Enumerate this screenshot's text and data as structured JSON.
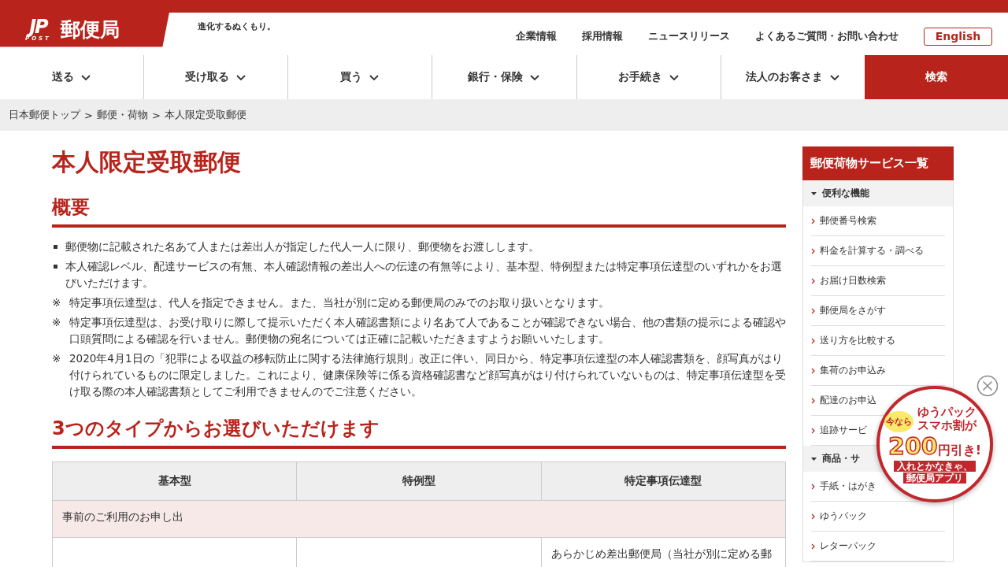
{
  "header": {
    "logo_mark": "JP",
    "logo_sub": "POST",
    "logo_text": "郵便局",
    "tagline": "進化するぬくもり。",
    "links": [
      "企業情報",
      "採用情報",
      "ニュースリリース",
      "よくあるご質問・お問い合わせ"
    ],
    "language_button": "English"
  },
  "nav": {
    "items": [
      {
        "label": "送る",
        "kind": "dropdown"
      },
      {
        "label": "受け取る",
        "kind": "dropdown"
      },
      {
        "label": "買う",
        "kind": "dropdown"
      },
      {
        "label": "銀行・保険",
        "kind": "dropdown"
      },
      {
        "label": "お手続き",
        "kind": "dropdown"
      },
      {
        "label": "法人のお客さま",
        "kind": "dropdown"
      },
      {
        "label": "検索",
        "kind": "search"
      }
    ]
  },
  "breadcrumb": {
    "items": [
      "日本郵便トップ",
      "郵便・荷物",
      "本人限定受取郵便"
    ],
    "separator": ">"
  },
  "page_title": "本人限定受取郵便",
  "sections": [
    {
      "heading": "概要",
      "notes": [
        {
          "kind": "bullet",
          "text": "郵便物に記載された名あて人または差出人が指定した代人一人に限り、郵便物をお渡しします。"
        },
        {
          "kind": "bullet",
          "text": "本人確認レベル、配達サービスの有無、本人確認情報の差出人への伝達の有無等により、基本型、特例型または特定事項伝達型のいずれかをお選びいただけます。"
        },
        {
          "kind": "note",
          "mark": "※",
          "text": "特定事項伝達型は、代人を指定できません。また、当社が別に定める郵便局のみでのお取り扱いとなります。"
        },
        {
          "kind": "note",
          "mark": "※",
          "text": "特定事項伝達型は、お受け取りに際して提示いただく本人確認書類により名あて人であることが確認できない場合、他の書類の提示による確認や口頭質問による確認を行いません。郵便物の宛名については正確に記載いただきますようお願いいたします。"
        },
        {
          "kind": "note",
          "mark": "※",
          "text": "2020年4月1日の「犯罪による収益の移転防止に関する法律施行規則」改正に伴い、同日から、特定事項伝達型の本人確認書類を、顔写真がはり付けられているものに限定しました。これにより、健康保険等に係る資格確認書など顔写真がはり付けられていないものは、特定事項伝達型を受け取る際の本人確認書類としてご利用できませんのでご注意ください。"
        }
      ]
    },
    {
      "heading": "3つのタイプからお選びいただけます",
      "table": {
        "columns": [
          "基本型",
          "特例型",
          "特定事項伝達型"
        ],
        "rows": [
          {
            "kind": "group",
            "text": "事前のご利用のお申し出"
          },
          {
            "kind": "data",
            "column_3": "あらかじめ差出郵便局（当社が別に定める郵"
          }
        ]
      }
    }
  ],
  "sidebar": {
    "title": "郵便荷物サービス一覧",
    "groups": [
      {
        "label": "便利な機能",
        "expanded": true,
        "items": [
          "郵便番号検索",
          "料金を計算する・調べる",
          "お届け日数検索",
          "郵便局をさがす",
          "送り方を比較する",
          "集荷のお申込み",
          "配達のお申込",
          "追跡サービ"
        ]
      },
      {
        "label": "商品・サ",
        "expanded": true,
        "items": [
          "手紙・はがき",
          "ゆうパック",
          "レターパック"
        ]
      }
    ]
  },
  "promo": {
    "badge": "今なら",
    "lines": [
      "ゆうパック",
      "スマホ割が"
    ],
    "amount": "200",
    "amount_suffix": "円引き!",
    "tagline": [
      "入れとかなきゃ、",
      "郵便局アプリ"
    ]
  }
}
